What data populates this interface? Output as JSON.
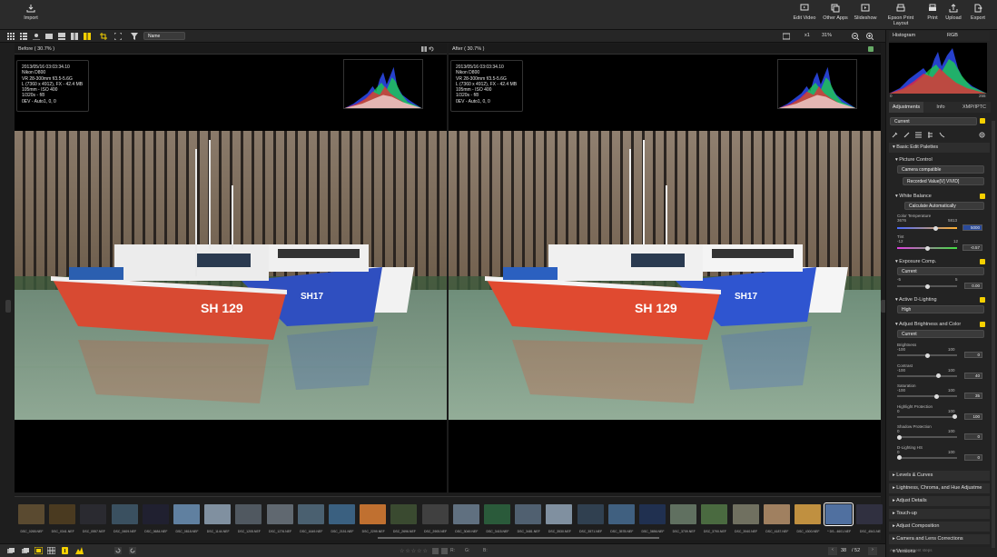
{
  "topbar": {
    "import_label": "Import",
    "edit_video_label": "Edit Video",
    "other_apps_label": "Other Apps",
    "slideshow_label": "Slideshow",
    "epson_label": "Epson Print Layout",
    "print_label": "Print",
    "upload_label": "Upload",
    "export_label": "Export"
  },
  "toolbar": {
    "sort_label": "Name",
    "zoom_level": "31%",
    "zoom_x1": "x1"
  },
  "before": {
    "title": "Before ( 30.7% )",
    "info_lines": [
      "2013/05/16 03:03:34.10",
      "Nikon D800",
      "VR 28-300mm f/3.5-5.6G",
      "L (7360 x 4912), FX - 42.4 MB",
      "105mm - ISO 400",
      "1/320s - f/8",
      "0EV - Auto1, 0, 0"
    ]
  },
  "after": {
    "title": "After ( 30.7% )",
    "info_lines": [
      "2013/05/16 03:03:34.10",
      "Nikon D800",
      "VR 28-300mm f/3.5-5.6G",
      "L (7360 x 4912), FX - 42.4 MB",
      "105mm - ISO 400",
      "1/320s - f/8",
      "0EV - Auto1, 0, 0"
    ]
  },
  "filmstrip": {
    "files": [
      "DSC_0265.NEF",
      "DSC_0341.NEF",
      "DSC_0557.NEF",
      "DSC_0609.NEF",
      "DSC_0684.NEF",
      "DSC_0818.NEF",
      "DSC_1144.NEF",
      "DSC_1205.NEF",
      "DSC_1276.NEF",
      "DSC_1649.NEF",
      "DSC_2151.NEF",
      "DSC_2299.NEF",
      "DSC_2696.NEF",
      "DSC_2905.NEF",
      "DSC_3049.NEF",
      "DSC_3415.NEF",
      "DSC_3481.NEF",
      "DSC_3530.NEF",
      "DSC_3571.NEF",
      "DSC_3578.NEF",
      "DSC_3656.NEF",
      "DSC_3709.NEF",
      "DSC_3790.NEF",
      "DSC_3940.NEF",
      "DSC_4187.NEF",
      "DSC_4300.NEF",
      "* DS...4601.NEF",
      "DSC_4541.NE"
    ]
  },
  "bottombar": {
    "stars": "☆☆☆☆☆",
    "r_label": "R:",
    "g_label": "G:",
    "b_label": "B:",
    "page": "38",
    "total": "/ 52"
  },
  "right": {
    "histogram_label": "Histogram",
    "channel": "RGB",
    "hist_min": "0",
    "hist_max": "255",
    "tabs": [
      "Adjustments",
      "Info",
      "XMP/IPTC"
    ],
    "preset": "Current",
    "basic_edit": "Basic Edit Palettes",
    "picture_control": {
      "label": "Picture Control",
      "value": "Camera compatible",
      "sub": "Recorded Value[V] VIVID]"
    },
    "white_balance": {
      "label": "White Balance",
      "value": "Calculate Automatically",
      "color_temp": "Color Temperature",
      "ct_left": "3676",
      "ct_right": "5813",
      "ct_value": "5000",
      "tint": "Tint",
      "tint_min": "-12",
      "tint_max": "12",
      "tint_value": "-0.57"
    },
    "exposure": {
      "label": "Exposure Comp.",
      "value": "Current",
      "min": "-5",
      "max": "5",
      "num": "0.00"
    },
    "adl": {
      "label": "Active D-Lighting",
      "value": "High"
    },
    "abc": {
      "label": "Adjust Brightness and Color",
      "value": "Current",
      "rows": [
        {
          "name": "Brightness",
          "min": "-100",
          "max": "100",
          "num": "0"
        },
        {
          "name": "Contrast",
          "min": "-100",
          "max": "100",
          "num": "40"
        },
        {
          "name": "Saturation",
          "min": "-100",
          "max": "100",
          "num": "35"
        },
        {
          "name": "Highlight Protection",
          "min": "0",
          "max": "100",
          "num": "100"
        },
        {
          "name": "Shadow Protection",
          "min": "0",
          "max": "100",
          "num": "0"
        },
        {
          "name": "D-Lighting HS",
          "min": "0",
          "max": "100",
          "num": "0"
        }
      ]
    },
    "collapsed": [
      "Levels & Curves",
      "Lightness, Chroma, and Hue Adjustme",
      "Adjust Details",
      "Touch-up",
      "Adjust Composition",
      "Camera and Lens Corrections",
      "Versions"
    ],
    "apply_steps": "Apply adjustment steps"
  },
  "colors": {
    "accent": "#f5d000",
    "bg": "#1c1c1c",
    "panel": "#232323"
  }
}
